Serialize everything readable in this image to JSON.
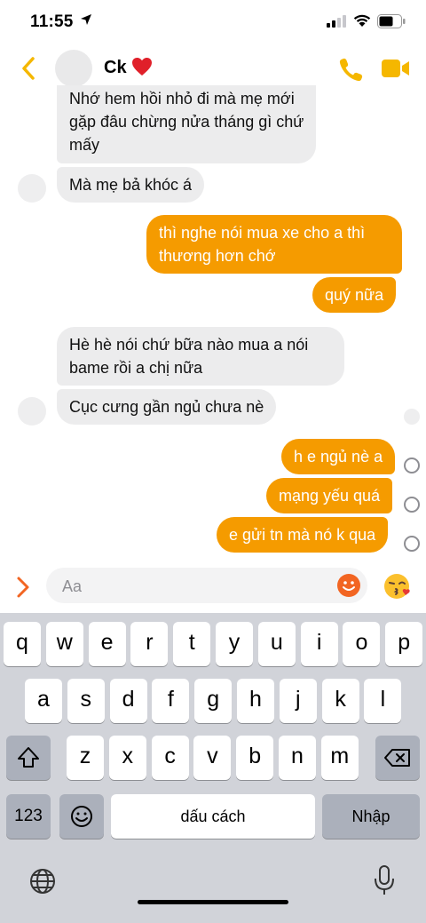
{
  "status_bar": {
    "time": "11:55"
  },
  "header": {
    "contact_name": "Ck"
  },
  "messages": [
    {
      "direction": "incoming",
      "lines": [
        "Nhớ hem hồi nhỏ đi mà mẹ mới",
        "gặp đâu chừng nửa tháng gì chứ",
        "mấy"
      ]
    },
    {
      "direction": "incoming",
      "lines": [
        "Mà mẹ bả khóc á"
      ]
    },
    {
      "direction": "outgoing",
      "lines": [
        "thì nghe nói mua xe cho a thì",
        "thương hơn chớ"
      ]
    },
    {
      "direction": "outgoing",
      "lines": [
        "quý nữa"
      ]
    },
    {
      "direction": "incoming",
      "lines": [
        "Hè hè nói chứ bữa nào mua a nói",
        "bame rồi a chị nữa"
      ]
    },
    {
      "direction": "incoming",
      "lines": [
        "Cục cưng gần ngủ chưa nè"
      ]
    },
    {
      "direction": "outgoing",
      "lines": [
        "h e ngủ nè a"
      ]
    },
    {
      "direction": "outgoing",
      "lines": [
        "mạng yếu quá"
      ]
    },
    {
      "direction": "outgoing",
      "lines": [
        "e gửi tn mà nó k qua"
      ]
    }
  ],
  "composer": {
    "placeholder": "Aa"
  },
  "keyboard": {
    "row1": [
      "q",
      "w",
      "e",
      "r",
      "t",
      "y",
      "u",
      "i",
      "o",
      "p"
    ],
    "row2": [
      "a",
      "s",
      "d",
      "f",
      "g",
      "h",
      "j",
      "k",
      "l"
    ],
    "row3": [
      "z",
      "x",
      "c",
      "v",
      "b",
      "n",
      "m"
    ],
    "numbers_label": "123",
    "space_label": "dấu cách",
    "return_label": "Nhập"
  },
  "colors": {
    "accent": "#f59b00",
    "incoming_bubble": "#ececed",
    "emoji_button": "#f26522"
  },
  "icons": [
    "location-arrow-icon",
    "signal-icon",
    "wifi-icon",
    "battery-icon",
    "back-chevron-icon",
    "heart-icon",
    "phone-icon",
    "video-camera-icon",
    "expand-chevron-icon",
    "emoji-icon",
    "kiss-emoji-icon",
    "shift-icon",
    "delete-icon",
    "emoji-keyboard-icon",
    "globe-icon",
    "microphone-icon"
  ]
}
